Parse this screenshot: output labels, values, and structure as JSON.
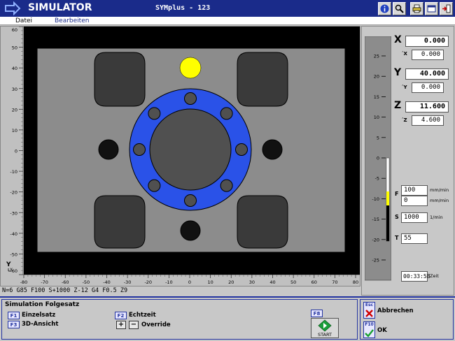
{
  "titlebar": {
    "app_title": "SIMULATOR",
    "program_title": "SYMplus - 123",
    "buttons": [
      "info-icon",
      "search-icon",
      "print-icon",
      "window-icon",
      "exit-icon"
    ]
  },
  "menu": {
    "items": [
      {
        "label": "Datei"
      },
      {
        "label": "Bearbeiten"
      }
    ]
  },
  "plot": {
    "y_ticks": [
      "60",
      "50",
      "40",
      "30",
      "20",
      "10",
      "0",
      "-10",
      "-20",
      "-30",
      "-40",
      "-50",
      "-60"
    ],
    "x_ticks": [
      "-80",
      "-70",
      "-60",
      "-50",
      "-40",
      "-30",
      "-20",
      "-10",
      "0",
      "10",
      "20",
      "30",
      "40",
      "50",
      "60",
      "70",
      "80"
    ],
    "axis_label": "Y",
    "axis_label_x": "X",
    "colors": {
      "blank": "#8c8c8c",
      "pocket": "#3a3a3a",
      "ring": "#2a52e8",
      "marker": "#ffff00",
      "hole": "#111111"
    }
  },
  "nc_line": "N=6 G85 F100 S+1000 Z-12 G4 F0.5 Z9",
  "position": {
    "x": {
      "label": "X",
      "value": "0.000",
      "delta_label": "´X",
      "delta": "0.000"
    },
    "y": {
      "label": "Y",
      "value": "40.000",
      "delta_label": "´Y",
      "delta": "0.000"
    },
    "z": {
      "label": "Z",
      "value": "11.600",
      "delta_label": "´Z",
      "delta": "4.600"
    }
  },
  "z_scale": {
    "ticks": [
      "25",
      "20",
      "15",
      "10",
      "5",
      "0",
      "-5",
      "-10",
      "-15",
      "-20",
      "-25"
    ]
  },
  "feed": {
    "f_label": "F",
    "f_value": "100",
    "f_unit": "mm/min",
    "f2_value": "0",
    "f2_unit": "mm/min",
    "s_label": "S",
    "s_value": "1000",
    "s_unit": "1/min",
    "t_label": "T",
    "t_value": "55",
    "time_value": "00:33:58",
    "time_label": "Zeit"
  },
  "bottom": {
    "title": "Simulation Folgesatz",
    "f1_key": "F1",
    "f1_label": "Einzelsatz",
    "f3_key": "F3",
    "f3_label": "3D-Ansicht",
    "f2_key": "F2",
    "f2_label": "Echtzeit",
    "plus": "+",
    "minus": "−",
    "override_label": "Override",
    "f8_key": "F8",
    "start_label": "START",
    "esc_key": "Esc",
    "cancel_label": "Abbrechen",
    "f10_key": "F10",
    "ok_label": "OK"
  }
}
